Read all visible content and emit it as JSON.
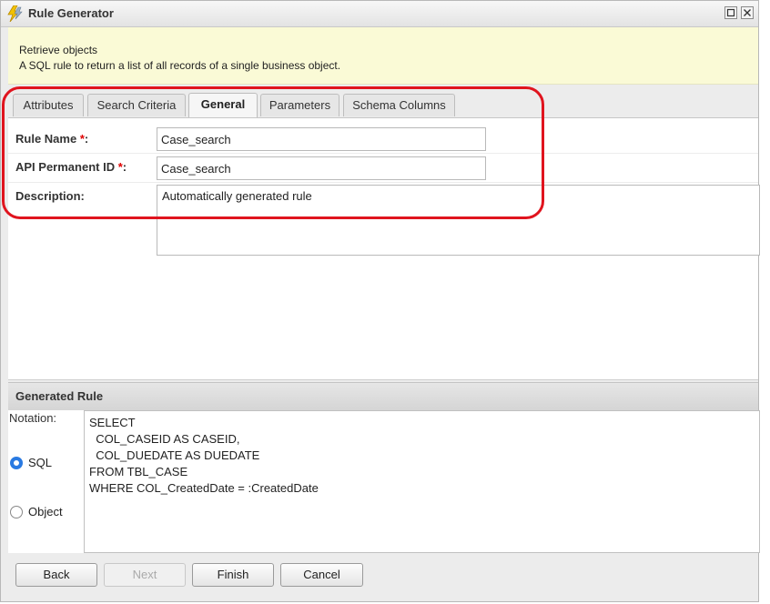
{
  "window": {
    "title": "Rule Generator"
  },
  "info": {
    "heading": "Retrieve objects",
    "description": "A SQL rule to return a list of all records of a single business object."
  },
  "tabs": [
    {
      "label": "Attributes"
    },
    {
      "label": "Search Criteria"
    },
    {
      "label": "General",
      "active": true
    },
    {
      "label": "Parameters"
    },
    {
      "label": "Schema Columns"
    }
  ],
  "form": {
    "rule_name_label": "Rule Name ",
    "rule_name_value": "Case_search",
    "api_id_label": "API Permanent ID ",
    "api_id_value": "Case_search",
    "description_label": "Description:",
    "description_value": "Automatically generated rule",
    "required_marker": "*",
    "colon": ":"
  },
  "generated_rule": {
    "title": "Generated Rule",
    "notation_label": "Notation:",
    "options": [
      {
        "label": "SQL",
        "selected": true
      },
      {
        "label": "Object",
        "selected": false
      }
    ],
    "sql_text": "SELECT\n  COL_CASEID AS CASEID,\n  COL_DUEDATE AS DUEDATE\nFROM TBL_CASE\nWHERE COL_CreatedDate = :CreatedDate"
  },
  "buttons": {
    "back": "Back",
    "next": "Next",
    "finish": "Finish",
    "cancel": "Cancel"
  },
  "colors": {
    "highlight": "#e0141e",
    "info_bg": "#fafad6",
    "required": "#e00000",
    "radio_selected": "#2a7ae2"
  },
  "icons": {
    "app": "lightning-bolt-icon",
    "maximize": "maximize-icon",
    "close": "close-icon"
  }
}
